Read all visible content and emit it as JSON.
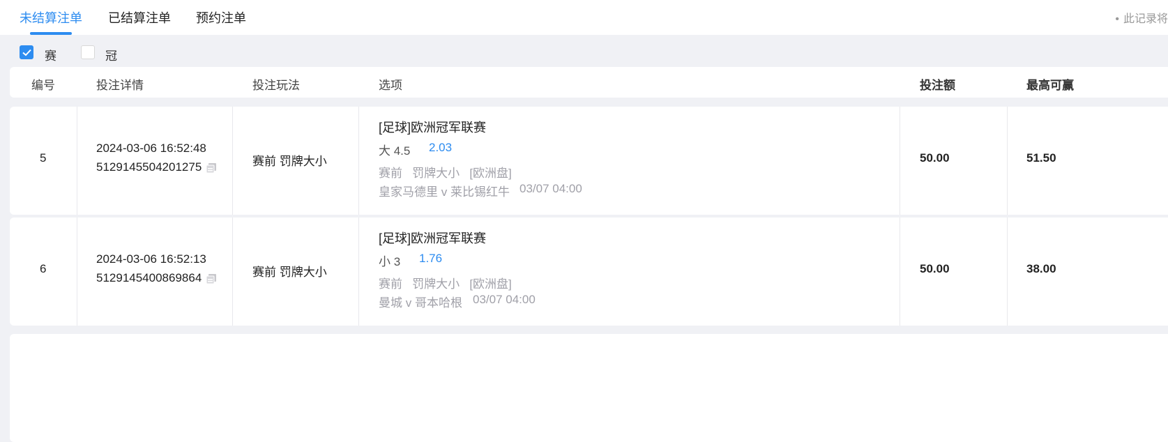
{
  "tabs": [
    {
      "label": "未结算注单",
      "active": true
    },
    {
      "label": "已结算注单",
      "active": false
    },
    {
      "label": "预约注单",
      "active": false
    }
  ],
  "notice": "此记录将",
  "filters": [
    {
      "label": "赛事",
      "checked": true
    },
    {
      "label": "冠军",
      "checked": false
    }
  ],
  "table": {
    "headers": [
      "编号",
      "投注详情",
      "投注玩法",
      "选项",
      "投注额",
      "最高可赢"
    ],
    "rows": [
      {
        "id": "5",
        "datetime": "2024-03-06 16:52:48",
        "order_no": "5129145504201275",
        "play": "赛前 罚牌大小",
        "league": "[足球]欧洲冠军联赛",
        "selection": "大 4.5",
        "odds": "2.03",
        "market": "赛前   罚牌大小   [欧洲盘]",
        "match": "皇家马德里 v 莱比锡红牛",
        "match_time": "03/07 04:00",
        "stake": "50.00",
        "max_win": "51.50"
      },
      {
        "id": "6",
        "datetime": "2024-03-06 16:52:13",
        "order_no": "5129145400869864",
        "play": "赛前 罚牌大小",
        "league": "[足球]欧洲冠军联赛",
        "selection": "小 3",
        "odds": "1.76",
        "market": "赛前   罚牌大小   [欧洲盘]",
        "match": "曼城 v 哥本哈根",
        "match_time": "03/07 04:00",
        "stake": "50.00",
        "max_win": "38.00"
      }
    ]
  },
  "colors": {
    "accent": "#2d8cf0",
    "muted": "#a0a0a8",
    "background": "#f0f1f5"
  },
  "icons": {
    "check": "check-icon",
    "copy": "copy-icon"
  }
}
